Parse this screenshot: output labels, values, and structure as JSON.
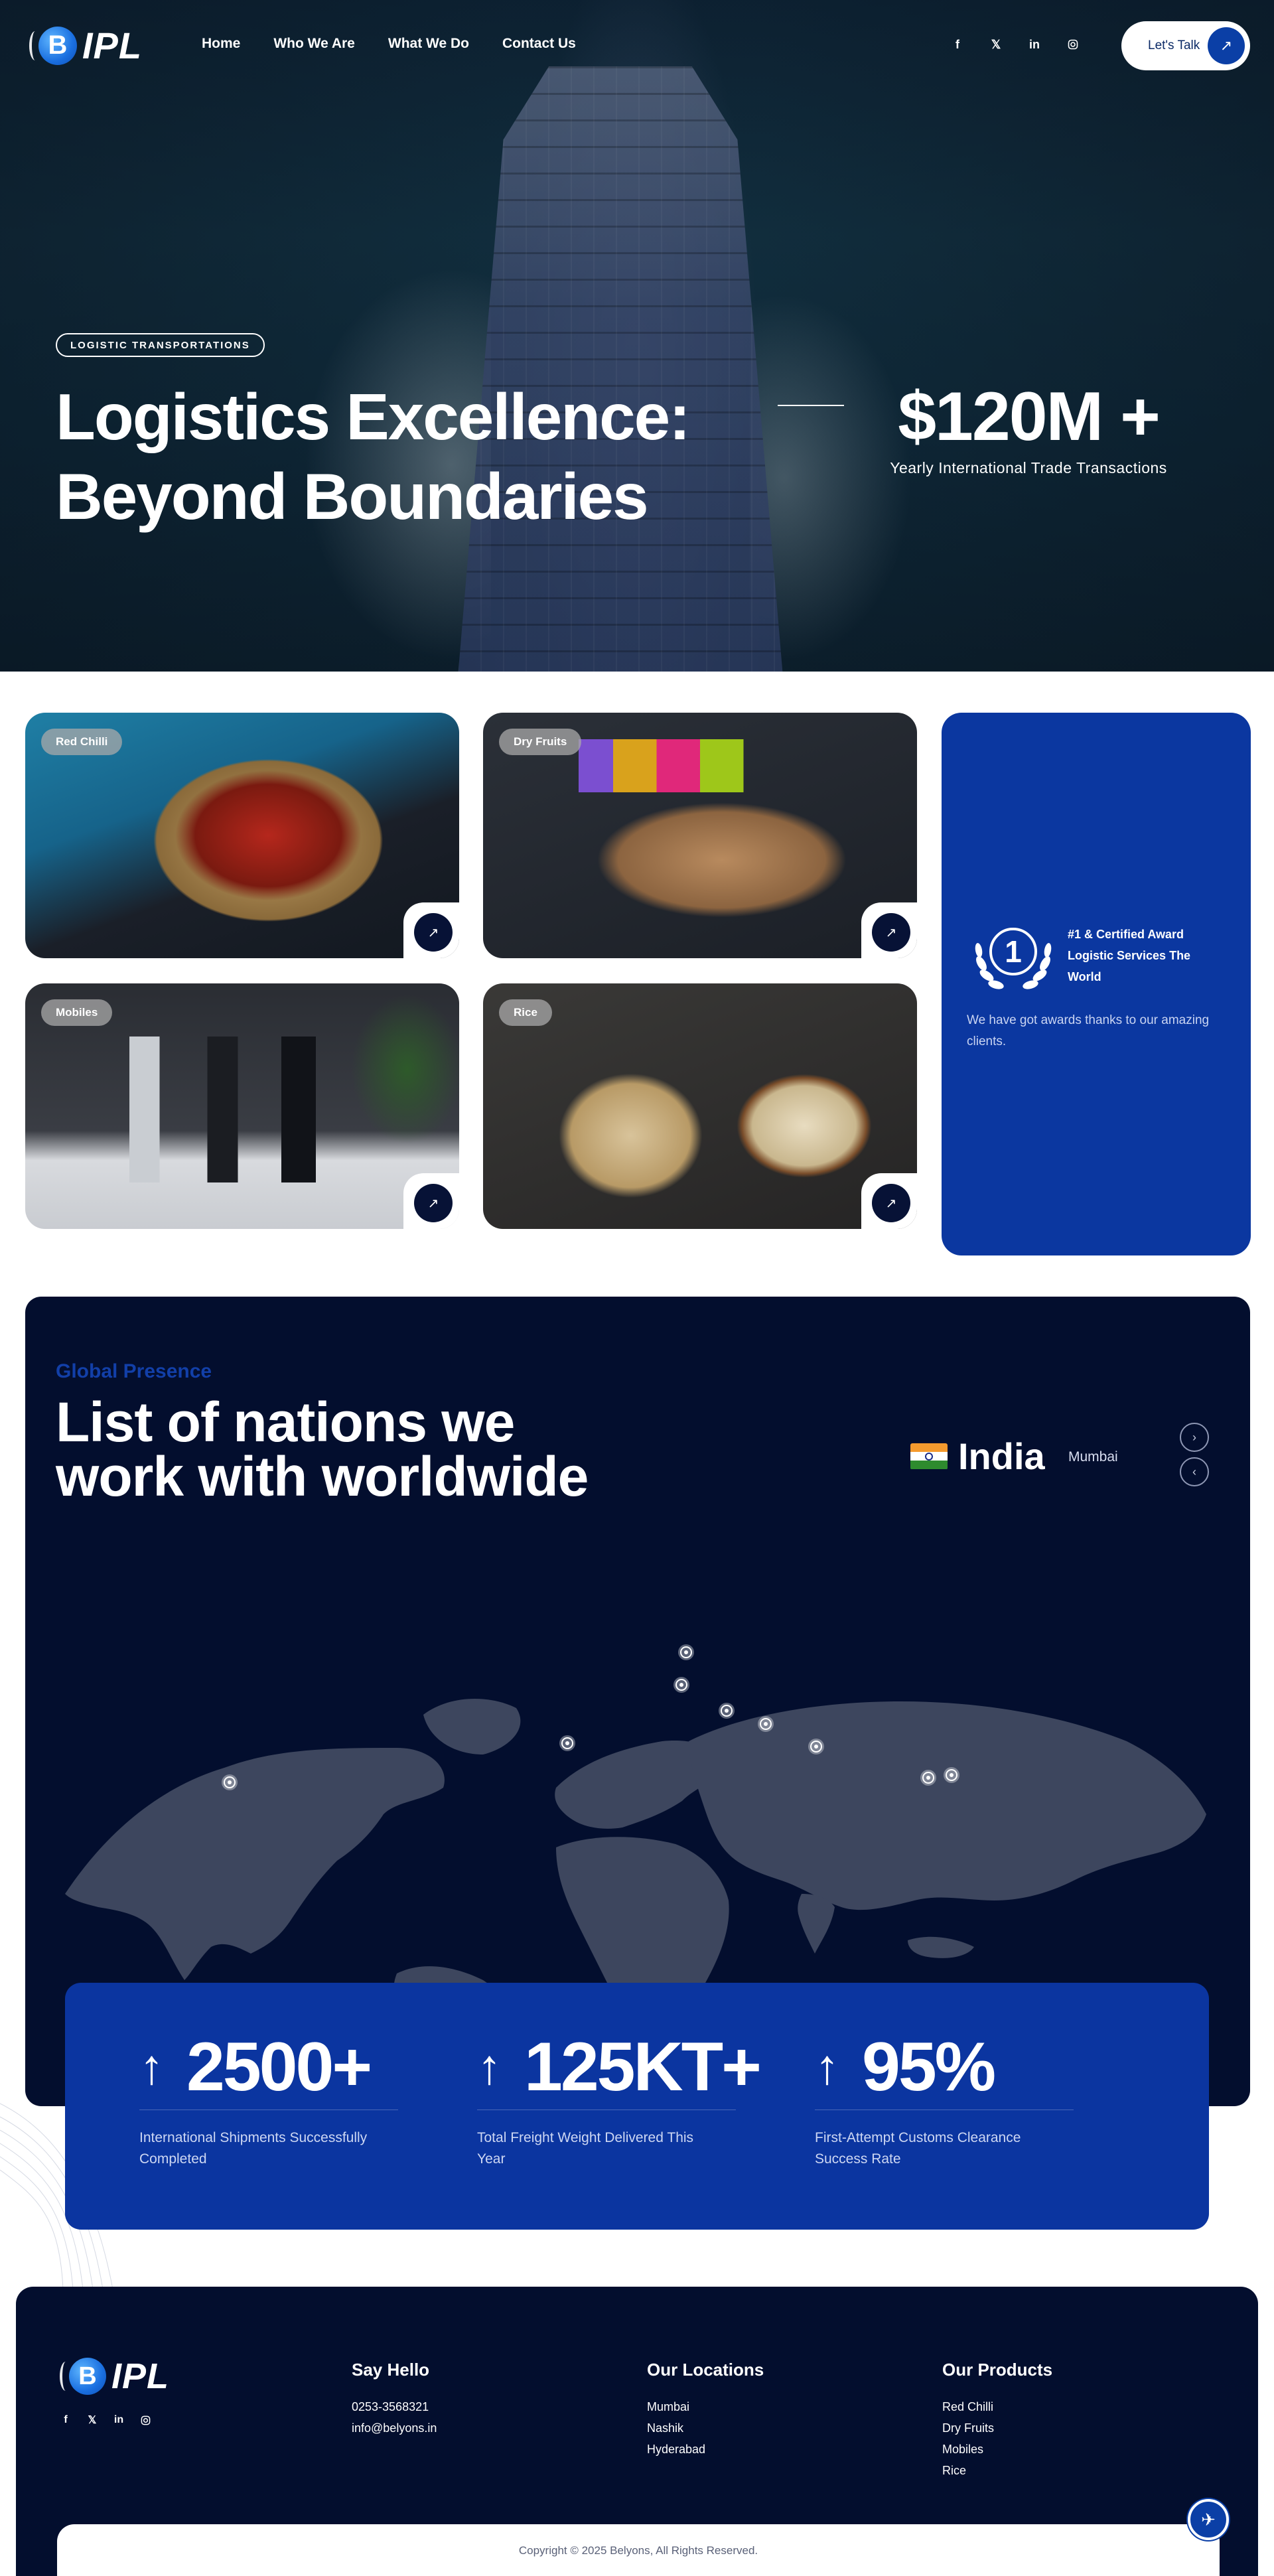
{
  "brand": {
    "logo_text": "IPL",
    "logo_letter": "B"
  },
  "nav": {
    "items": [
      "Home",
      "Who We Are",
      "What We Do",
      "Contact Us"
    ],
    "socials": [
      "facebook-icon",
      "x-icon",
      "linkedin-icon",
      "instagram-icon"
    ],
    "cta_label": "Let's Talk"
  },
  "hero": {
    "tag": "LOGISTIC TRANSPORTATIONS",
    "title_line1": "Logistics Excellence:",
    "title_line2": "Beyond Boundaries",
    "stat_value": "$120M +",
    "stat_caption": "Yearly International Trade Transactions"
  },
  "products": [
    {
      "label": "Red Chilli"
    },
    {
      "label": "Dry Fruits"
    },
    {
      "label": "Mobiles"
    },
    {
      "label": "Rice"
    }
  ],
  "award": {
    "badge_number": "1",
    "title": "#1 & Certified Award Logistic Services The World",
    "description": "We have got awards thanks to our amazing clients."
  },
  "presence": {
    "eyebrow": "Global Presence",
    "heading_line1": "List of nations we",
    "heading_line2": "work with worldwide",
    "country": "India",
    "city": "Mumbai",
    "flag_colors": {
      "saffron": "#f59a2e",
      "white": "#ffffff",
      "green": "#2e8b2e"
    }
  },
  "stats": [
    {
      "value": "2500+",
      "label": "International Shipments Successfully Completed"
    },
    {
      "value": "125KT+",
      "label": "Total Freight Weight Delivered This Year"
    },
    {
      "value": "95%",
      "label": "First-Attempt Customs Clearance Success Rate"
    }
  ],
  "footer": {
    "hello": {
      "title": "Say Hello",
      "phone": "0253-3568321",
      "email": "info@belyons.in"
    },
    "locations": {
      "title": "Our Locations",
      "items": [
        "Mumbai",
        "Nashik",
        "Hyderabad"
      ]
    },
    "products": {
      "title": "Our Products",
      "items": [
        "Red Chilli",
        "Dry Fruits",
        "Mobiles",
        "Rice"
      ]
    },
    "copyright": "Copyright © 2025 Belyons, All Rights Reserved."
  },
  "colors": {
    "navy": "#030e2e",
    "royal_blue": "#0b37a0",
    "accent_text": "#123fa8"
  }
}
